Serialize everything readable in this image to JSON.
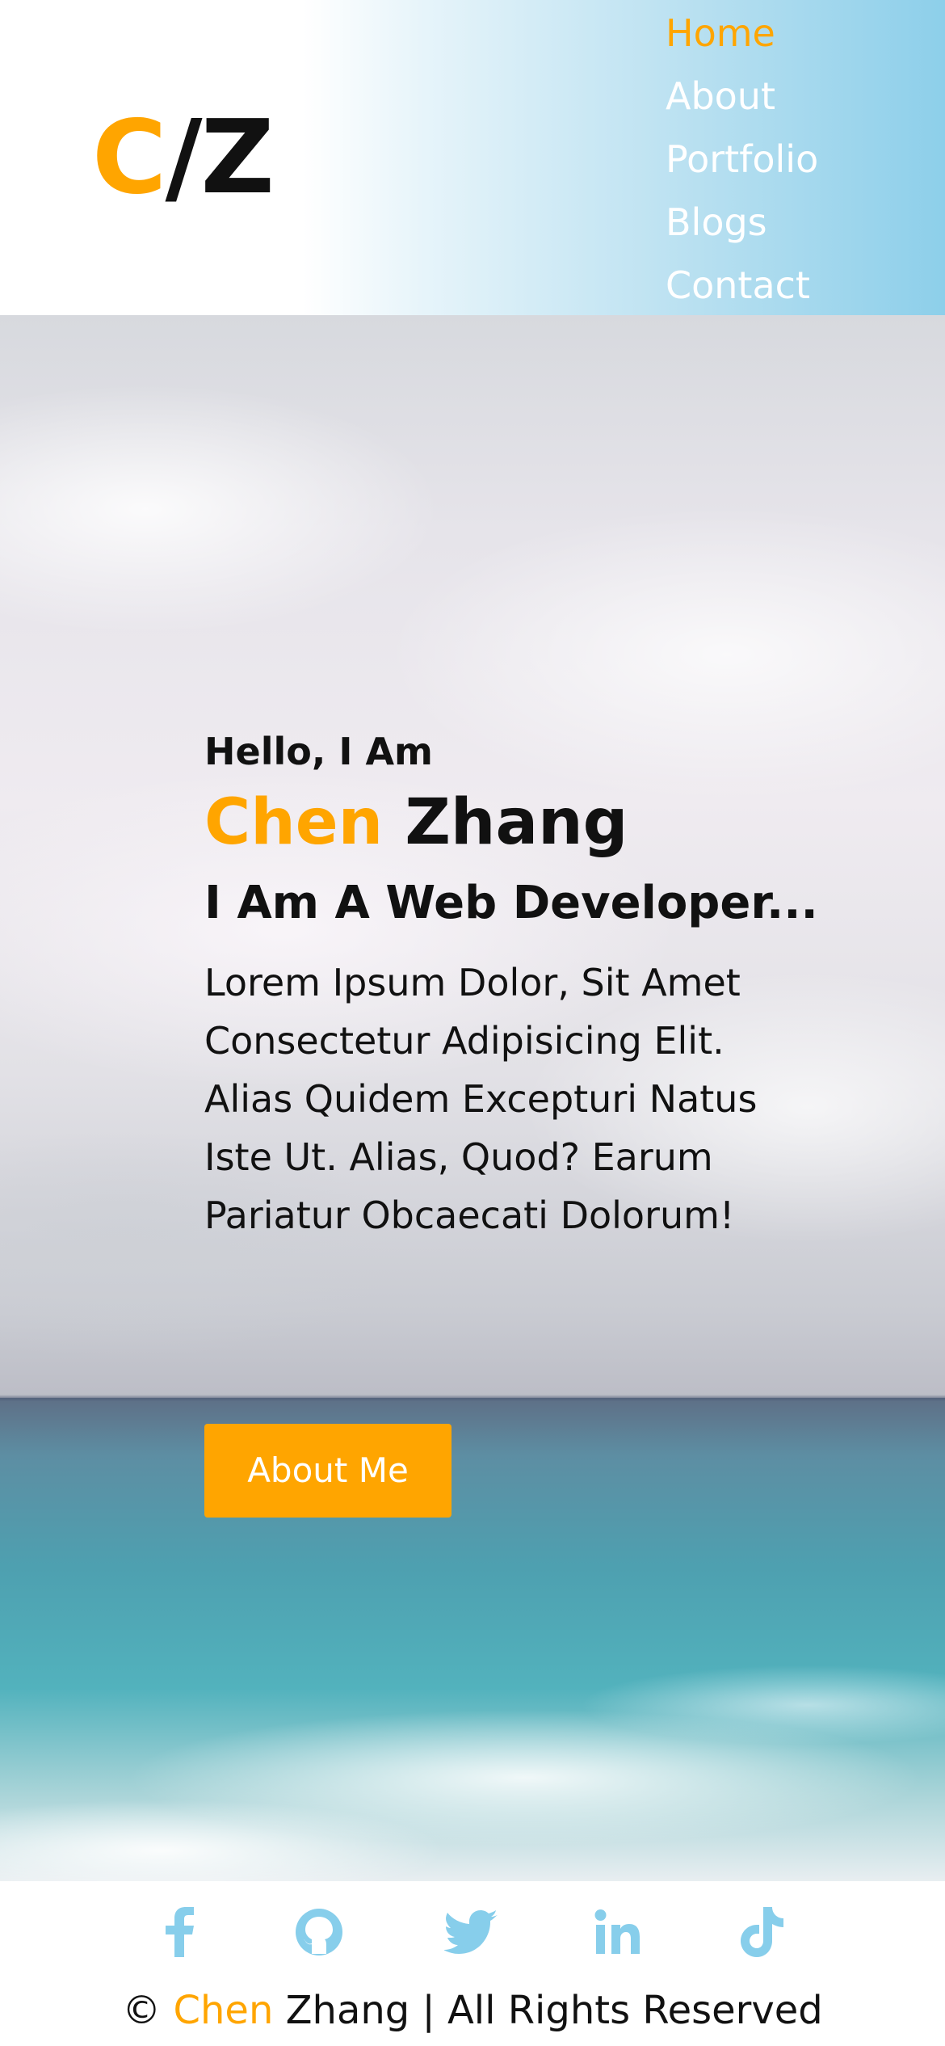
{
  "colors": {
    "accent": "#ffa500",
    "social_icon": "#87ceeb",
    "text": "#111111",
    "nav_text": "#ffffff"
  },
  "header": {
    "logo": {
      "first": "C",
      "rest": "/Z"
    },
    "nav": [
      {
        "label": "Home",
        "active": true
      },
      {
        "label": "About",
        "active": false
      },
      {
        "label": "Portfolio",
        "active": false
      },
      {
        "label": "Blogs",
        "active": false
      },
      {
        "label": "Contact",
        "active": false
      }
    ]
  },
  "hero": {
    "greeting": "Hello, I Am",
    "first_name": "Chen",
    "last_name": "Zhang",
    "role": "I Am A Web Developer...",
    "bio": "Lorem Ipsum Dolor, Sit Amet Consectetur Adipisicing Elit. Alias Quidem Excepturi Natus Iste Ut. Alias, Quod? Earum Pariatur Obcaecati Dolorum!",
    "cta_label": "About Me"
  },
  "footer": {
    "social": [
      "facebook-icon",
      "github-icon",
      "twitter-icon",
      "linkedin-icon",
      "tiktok-icon"
    ],
    "copyright_prefix": "©",
    "copyright_first": "Chen",
    "copyright_rest": "Zhang | All Rights Reserved"
  }
}
